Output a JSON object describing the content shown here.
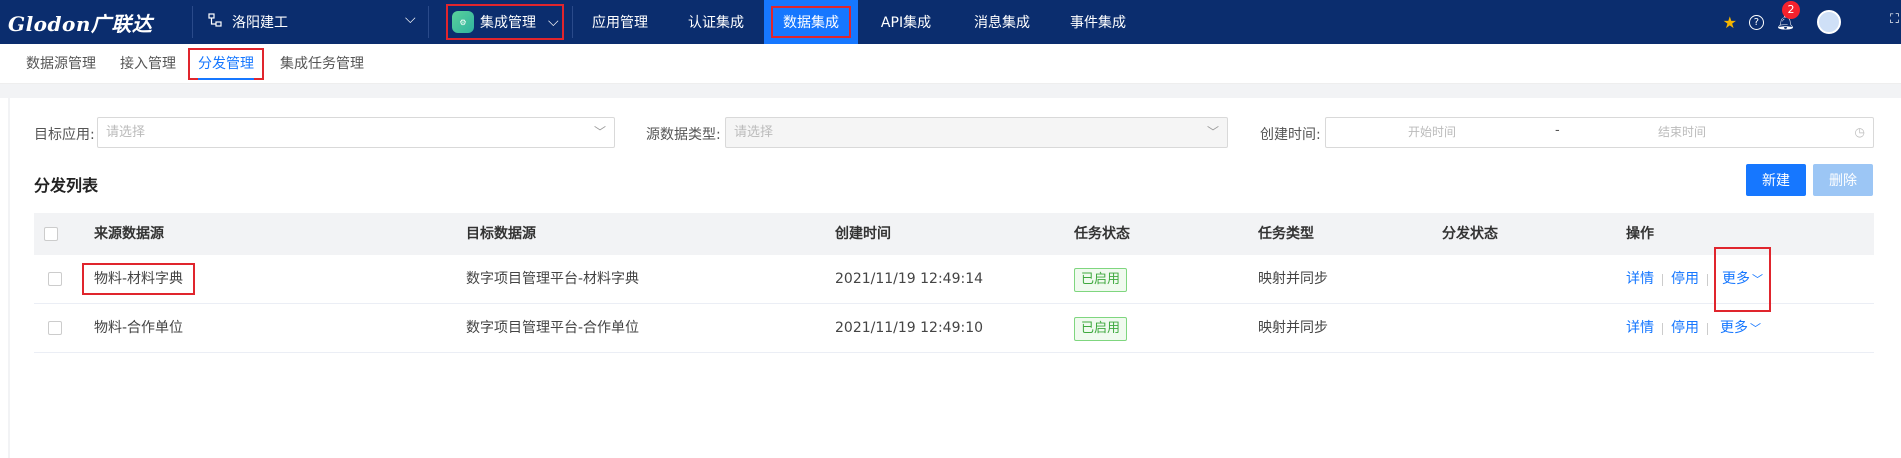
{
  "brand": {
    "logo": "Glodon广联达"
  },
  "org": {
    "name": "洛阳建工"
  },
  "app_switcher": {
    "label": "集成管理"
  },
  "top_nav": [
    {
      "label": "应用管理"
    },
    {
      "label": "认证集成"
    },
    {
      "label": "数据集成",
      "active": true
    },
    {
      "label": "API集成"
    },
    {
      "label": "消息集成"
    },
    {
      "label": "事件集成"
    }
  ],
  "notifications": {
    "count": "2"
  },
  "sub_tabs": [
    {
      "label": "数据源管理"
    },
    {
      "label": "接入管理"
    },
    {
      "label": "分发管理",
      "active": true
    },
    {
      "label": "集成任务管理"
    }
  ],
  "filters": {
    "target_app": {
      "label": "目标应用:",
      "placeholder": "请选择"
    },
    "source_type": {
      "label": "源数据类型:",
      "placeholder": "请选择"
    },
    "created_time": {
      "label": "创建时间:",
      "start_placeholder": "开始时间",
      "separator": "-",
      "end_placeholder": "结束时间"
    }
  },
  "list": {
    "title": "分发列表",
    "new_button": "新建",
    "delete_button": "删除"
  },
  "table": {
    "headers": [
      "来源数据源",
      "目标数据源",
      "创建时间",
      "任务状态",
      "任务类型",
      "分发状态",
      "操作"
    ],
    "rows": [
      {
        "source": "物料-材料字典",
        "target": "数字项目管理平台-材料字典",
        "created": "2021/11/19 12:49:14",
        "status": "已启用",
        "type": "映射并同步",
        "dist_status": "",
        "ops": {
          "detail": "详情",
          "disable": "停用",
          "more": "更多"
        }
      },
      {
        "source": "物料-合作单位",
        "target": "数字项目管理平台-合作单位",
        "created": "2021/11/19 12:49:10",
        "status": "已启用",
        "type": "映射并同步",
        "dist_status": "",
        "ops": {
          "detail": "详情",
          "disable": "停用",
          "more": "更多"
        }
      }
    ]
  },
  "colors": {
    "topbar": "#0b2d6e",
    "primary": "#1677ff",
    "highlight": "#e0252d",
    "status_green": "#3fa93f"
  },
  "icons": [
    "org-tree-icon",
    "chevron-down-icon",
    "star-icon",
    "help-icon",
    "bell-icon",
    "clock-icon",
    "fullscreen-icon"
  ]
}
